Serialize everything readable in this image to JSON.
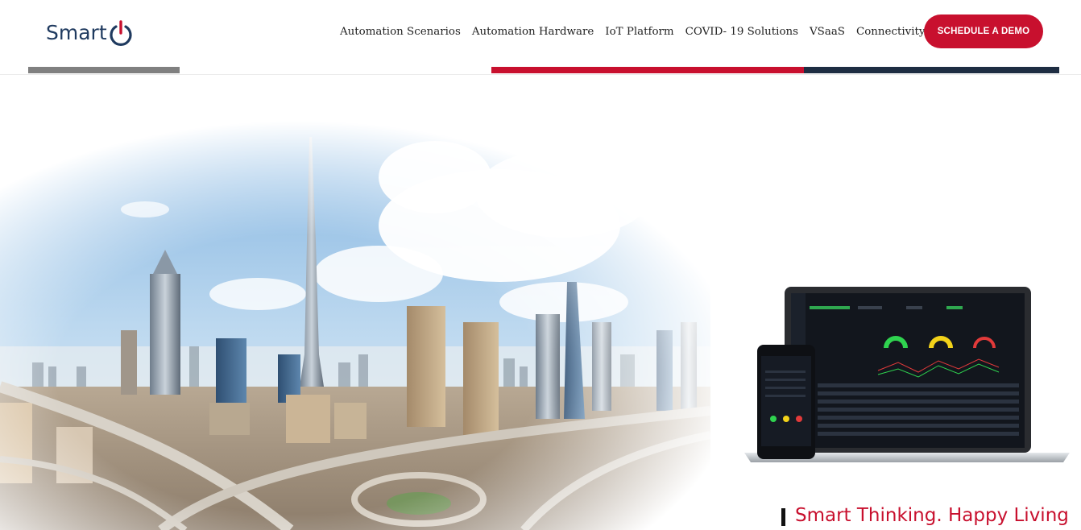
{
  "brand": {
    "name": "Smart",
    "navy": "#1f3a5f",
    "red": "#c8102e"
  },
  "nav": {
    "items": [
      {
        "label": "Automation Scenarios"
      },
      {
        "label": "Automation Hardware"
      },
      {
        "label": "IoT Platform"
      },
      {
        "label": "COVID- 19 Solutions"
      },
      {
        "label": "VSaaS"
      },
      {
        "label": "Connectivity"
      }
    ],
    "cta_label": "SCHEDULE A DEMO"
  },
  "hero": {
    "tagline": "Smart Thinking. Happy Living"
  },
  "icons": {
    "logo": "power-icon"
  }
}
